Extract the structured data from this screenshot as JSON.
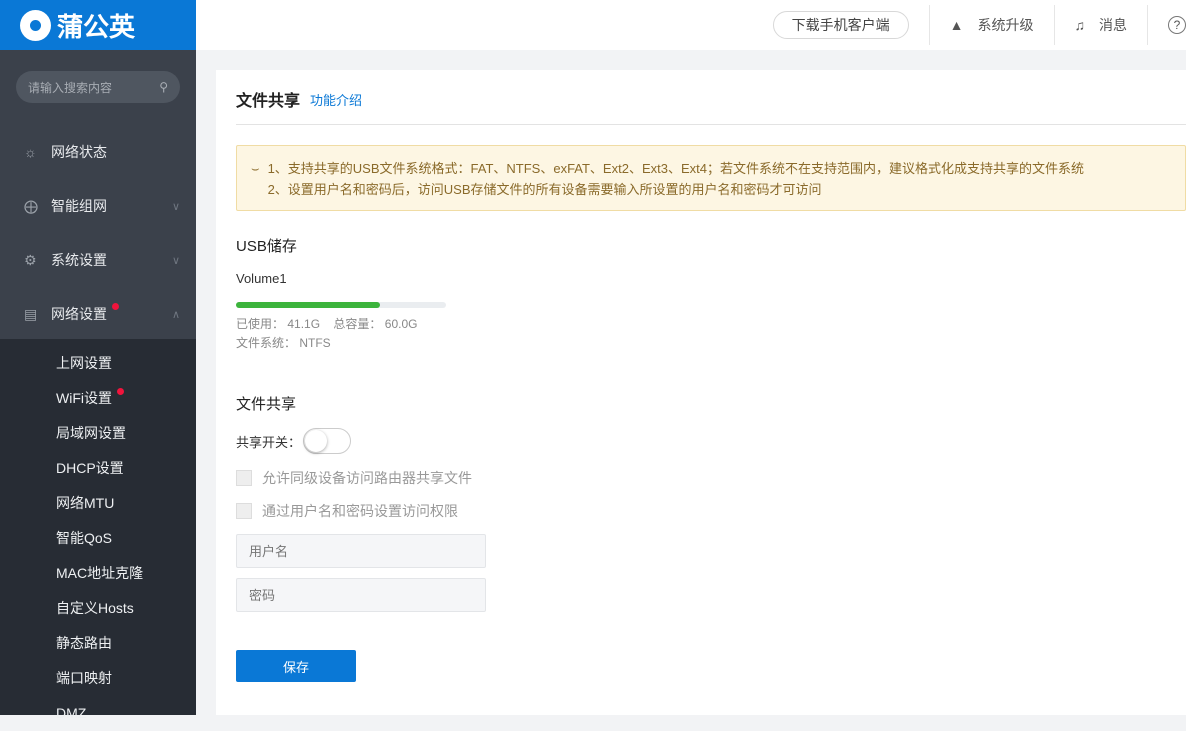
{
  "brand": "蒲公英",
  "search": {
    "placeholder": "请输入搜索内容"
  },
  "nav": [
    {
      "label": "网络状态"
    },
    {
      "label": "智能组网"
    },
    {
      "label": "系统设置"
    },
    {
      "label": "网络设置"
    }
  ],
  "subnav": [
    "上网设置",
    "WiFi设置",
    "局域网设置",
    "DHCP设置",
    "网络MTU",
    "智能QoS",
    "MAC地址克隆",
    "自定义Hosts",
    "静态路由",
    "端口映射",
    "DMZ"
  ],
  "topbar": {
    "download": "下载手机客户端",
    "upgrade": "系统升级",
    "messages": "消息",
    "help": "?"
  },
  "page": {
    "title": "文件共享",
    "intro_link": "功能介绍",
    "tips": [
      "1、支持共享的USB文件系统格式：FAT、NTFS、exFAT、Ext2、Ext3、Ext4；若文件系统不在支持范围内，建议格式化成支持共享的文件系统",
      "2、设置用户名和密码后，访问USB存储文件的所有设备需要输入所设置的用户名和密码才可访问"
    ],
    "usb": {
      "heading": "USB储存",
      "volume": "Volume1",
      "used_label": "已使用：",
      "used": "41.1G",
      "total_label": "总容量：",
      "total": "60.0G",
      "fs_label": "文件系统：",
      "fs": "NTFS",
      "usage_percent": 68.5
    },
    "share": {
      "heading": "文件共享",
      "switch_label": "共享开关：",
      "switch_on": false,
      "opt1": "允许同级设备访问路由器共享文件",
      "opt2": "通过用户名和密码设置访问权限",
      "username_placeholder": "用户名",
      "password_placeholder": "密码",
      "save": "保存"
    }
  }
}
